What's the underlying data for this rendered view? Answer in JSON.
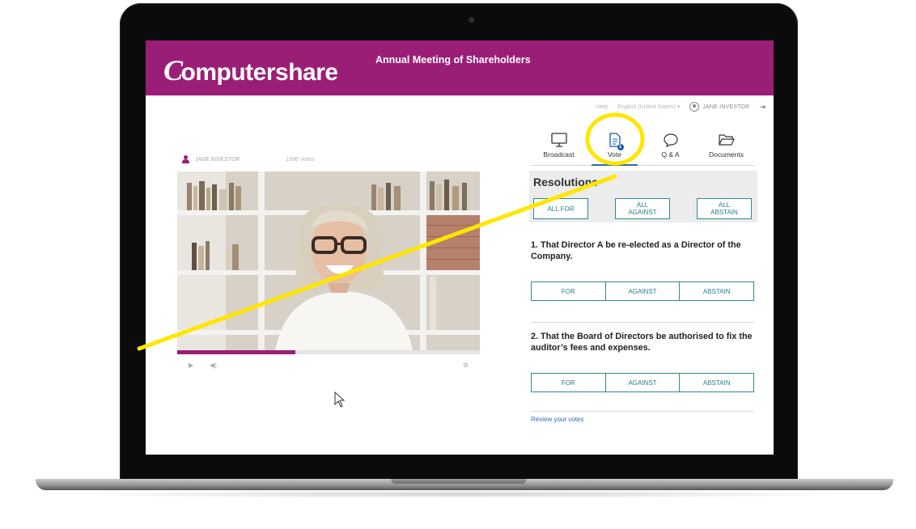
{
  "app": {
    "brand": "Computershare",
    "title": "Annual Meeting of Shareholders"
  },
  "topbar": {
    "help": "Help",
    "language": "English (United States) ▾",
    "user": "JANE INVESTOR"
  },
  "presenter": {
    "name": "JANE INVESTOR",
    "votes": "1096 Votes"
  },
  "video": {
    "progress_fraction": 0.39
  },
  "tabs": [
    {
      "label": "Broadcast",
      "icon": "monitor-icon"
    },
    {
      "label": "Vote",
      "icon": "document-icon",
      "badge": "1",
      "active": true
    },
    {
      "label": "Q & A",
      "icon": "speech-bubble-icon"
    },
    {
      "label": "Documents",
      "icon": "folder-icon"
    }
  ],
  "resolutions": {
    "heading": "Resolutions",
    "bulk": {
      "all_for": "ALL FOR",
      "all_against_1": "ALL",
      "all_against_2": "AGAINST",
      "all_abstain_1": "ALL",
      "all_abstain_2": "ABSTAIN"
    },
    "items": [
      {
        "text": "1. That Director A be re-elected as a Director of the Company.",
        "for": "FOR",
        "against": "AGAINST",
        "abstain": "ABSTAIN"
      },
      {
        "text": "2. That the Board of Directors be authorised to fix the auditor’s fees and expenses.",
        "for": "FOR",
        "against": "AGAINST",
        "abstain": "ABSTAIN"
      }
    ],
    "review": "Review your votes"
  },
  "colors": {
    "brand": "#9b1e76",
    "accent": "#2a7c88",
    "highlight": "#ffe600"
  }
}
